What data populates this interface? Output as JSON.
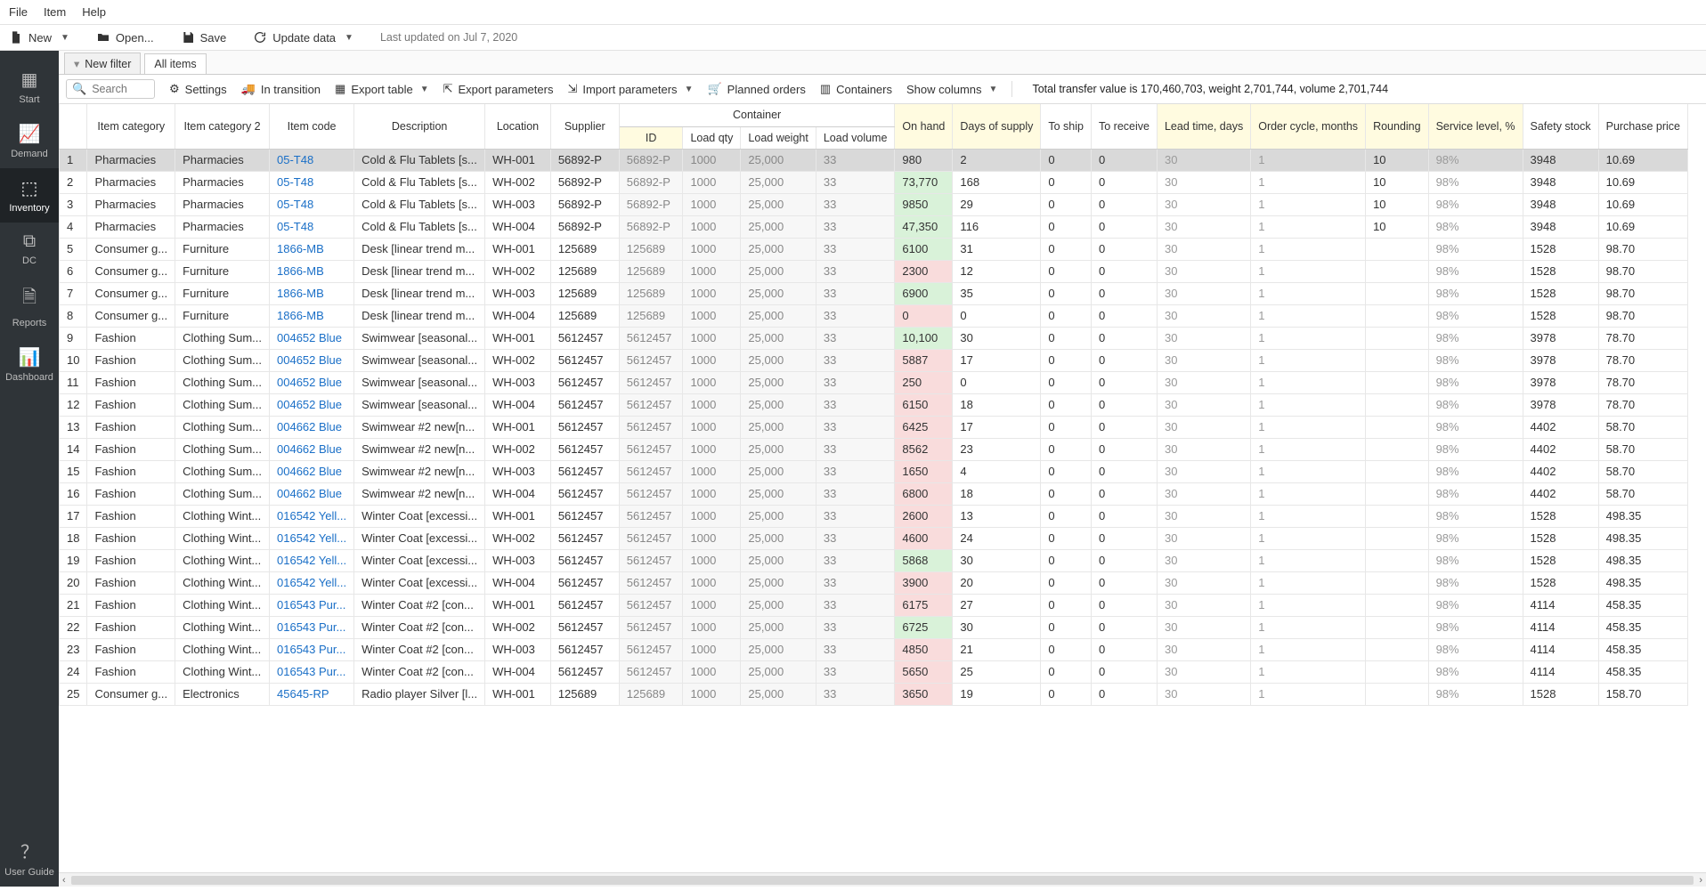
{
  "menubar": [
    "File",
    "Item",
    "Help"
  ],
  "toolbar": {
    "new": "New",
    "open": "Open...",
    "save": "Save",
    "update": "Update data",
    "timestamp": "Last updated on Jul 7, 2020"
  },
  "sidebar": {
    "items": [
      {
        "label": "Start",
        "icon": "grid"
      },
      {
        "label": "Demand",
        "icon": "line"
      },
      {
        "label": "Inventory",
        "icon": "cube",
        "active": true
      },
      {
        "label": "DC",
        "icon": "boxes"
      },
      {
        "label": "Reports",
        "icon": "doc"
      },
      {
        "label": "Dashboard",
        "icon": "bar"
      }
    ],
    "guide": "User Guide"
  },
  "tabs": {
    "newfilter": "New filter",
    "allitems": "All items"
  },
  "toolrow": {
    "search_placeholder": "Search",
    "settings": "Settings",
    "transition": "In transition",
    "export_table": "Export table",
    "export_params": "Export parameters",
    "import_params": "Import parameters",
    "planned": "Planned orders",
    "containers": "Containers",
    "show_cols": "Show columns",
    "summary": "Total transfer value is 170,460,703, weight 2,701,744, volume 2,701,744"
  },
  "columns": {
    "item_cat": "Item category",
    "item_cat2": "Item category 2",
    "item_code": "Item code",
    "desc": "Description",
    "location": "Location",
    "supplier": "Supplier",
    "container_group": "Container",
    "id": "ID",
    "load_qty": "Load qty",
    "load_wt": "Load weight",
    "load_vol": "Load volume",
    "on_hand": "On hand",
    "days_supply": "Days of supply",
    "to_ship": "To ship",
    "to_recv": "To receive",
    "lead_time": "Lead time, days",
    "order_cycle": "Order cycle, months",
    "rounding": "Rounding",
    "service": "Service level, %",
    "safety": "Safety stock",
    "price": "Purchase price"
  },
  "rows": [
    {
      "n": 1,
      "cat": "Pharmacies",
      "cat2": "Pharmacies",
      "code": "05-T48",
      "desc": "Cold & Flu Tablets [s...",
      "loc": "WH-001",
      "sup": "56892-P",
      "cid": "56892-P",
      "lq": "1000",
      "lw": "25,000",
      "lv": "33",
      "oh": "980",
      "oh_c": "r",
      "ds": "2",
      "ship": "0",
      "recv": "0",
      "lt": "30",
      "oc": "1",
      "rnd": "10",
      "sl": "98%",
      "ss": "3948",
      "pp": "10.69",
      "sel": true
    },
    {
      "n": 2,
      "cat": "Pharmacies",
      "cat2": "Pharmacies",
      "code": "05-T48",
      "desc": "Cold & Flu Tablets [s...",
      "loc": "WH-002",
      "sup": "56892-P",
      "cid": "56892-P",
      "lq": "1000",
      "lw": "25,000",
      "lv": "33",
      "oh": "73,770",
      "oh_c": "g",
      "ds": "168",
      "ship": "0",
      "recv": "0",
      "lt": "30",
      "oc": "1",
      "rnd": "10",
      "sl": "98%",
      "ss": "3948",
      "pp": "10.69"
    },
    {
      "n": 3,
      "cat": "Pharmacies",
      "cat2": "Pharmacies",
      "code": "05-T48",
      "desc": "Cold & Flu Tablets [s...",
      "loc": "WH-003",
      "sup": "56892-P",
      "cid": "56892-P",
      "lq": "1000",
      "lw": "25,000",
      "lv": "33",
      "oh": "9850",
      "oh_c": "g",
      "ds": "29",
      "ship": "0",
      "recv": "0",
      "lt": "30",
      "oc": "1",
      "rnd": "10",
      "sl": "98%",
      "ss": "3948",
      "pp": "10.69"
    },
    {
      "n": 4,
      "cat": "Pharmacies",
      "cat2": "Pharmacies",
      "code": "05-T48",
      "desc": "Cold & Flu Tablets [s...",
      "loc": "WH-004",
      "sup": "56892-P",
      "cid": "56892-P",
      "lq": "1000",
      "lw": "25,000",
      "lv": "33",
      "oh": "47,350",
      "oh_c": "g",
      "ds": "116",
      "ship": "0",
      "recv": "0",
      "lt": "30",
      "oc": "1",
      "rnd": "10",
      "sl": "98%",
      "ss": "3948",
      "pp": "10.69"
    },
    {
      "n": 5,
      "cat": "Consumer g...",
      "cat2": "Furniture",
      "code": "1866-MB",
      "desc": "Desk [linear trend m...",
      "loc": "WH-001",
      "sup": "125689",
      "cid": "125689",
      "lq": "1000",
      "lw": "25,000",
      "lv": "33",
      "oh": "6100",
      "oh_c": "g",
      "ds": "31",
      "ship": "0",
      "recv": "0",
      "lt": "30",
      "oc": "1",
      "rnd": "",
      "sl": "98%",
      "ss": "1528",
      "pp": "98.70"
    },
    {
      "n": 6,
      "cat": "Consumer g...",
      "cat2": "Furniture",
      "code": "1866-MB",
      "desc": "Desk [linear trend m...",
      "loc": "WH-002",
      "sup": "125689",
      "cid": "125689",
      "lq": "1000",
      "lw": "25,000",
      "lv": "33",
      "oh": "2300",
      "oh_c": "r",
      "ds": "12",
      "ship": "0",
      "recv": "0",
      "lt": "30",
      "oc": "1",
      "rnd": "",
      "sl": "98%",
      "ss": "1528",
      "pp": "98.70"
    },
    {
      "n": 7,
      "cat": "Consumer g...",
      "cat2": "Furniture",
      "code": "1866-MB",
      "desc": "Desk [linear trend m...",
      "loc": "WH-003",
      "sup": "125689",
      "cid": "125689",
      "lq": "1000",
      "lw": "25,000",
      "lv": "33",
      "oh": "6900",
      "oh_c": "g",
      "ds": "35",
      "ship": "0",
      "recv": "0",
      "lt": "30",
      "oc": "1",
      "rnd": "",
      "sl": "98%",
      "ss": "1528",
      "pp": "98.70"
    },
    {
      "n": 8,
      "cat": "Consumer g...",
      "cat2": "Furniture",
      "code": "1866-MB",
      "desc": "Desk [linear trend m...",
      "loc": "WH-004",
      "sup": "125689",
      "cid": "125689",
      "lq": "1000",
      "lw": "25,000",
      "lv": "33",
      "oh": "0",
      "oh_c": "r",
      "ds": "0",
      "ship": "0",
      "recv": "0",
      "lt": "30",
      "oc": "1",
      "rnd": "",
      "sl": "98%",
      "ss": "1528",
      "pp": "98.70"
    },
    {
      "n": 9,
      "cat": "Fashion",
      "cat2": "Clothing Sum...",
      "code": "004652 Blue",
      "desc": "Swimwear [seasonal...",
      "loc": "WH-001",
      "sup": "5612457",
      "cid": "5612457",
      "lq": "1000",
      "lw": "25,000",
      "lv": "33",
      "oh": "10,100",
      "oh_c": "g",
      "ds": "30",
      "ship": "0",
      "recv": "0",
      "lt": "30",
      "oc": "1",
      "rnd": "",
      "sl": "98%",
      "ss": "3978",
      "pp": "78.70"
    },
    {
      "n": 10,
      "cat": "Fashion",
      "cat2": "Clothing Sum...",
      "code": "004652 Blue",
      "desc": "Swimwear [seasonal...",
      "loc": "WH-002",
      "sup": "5612457",
      "cid": "5612457",
      "lq": "1000",
      "lw": "25,000",
      "lv": "33",
      "oh": "5887",
      "oh_c": "r",
      "ds": "17",
      "ship": "0",
      "recv": "0",
      "lt": "30",
      "oc": "1",
      "rnd": "",
      "sl": "98%",
      "ss": "3978",
      "pp": "78.70"
    },
    {
      "n": 11,
      "cat": "Fashion",
      "cat2": "Clothing Sum...",
      "code": "004652 Blue",
      "desc": "Swimwear [seasonal...",
      "loc": "WH-003",
      "sup": "5612457",
      "cid": "5612457",
      "lq": "1000",
      "lw": "25,000",
      "lv": "33",
      "oh": "250",
      "oh_c": "r",
      "ds": "0",
      "ship": "0",
      "recv": "0",
      "lt": "30",
      "oc": "1",
      "rnd": "",
      "sl": "98%",
      "ss": "3978",
      "pp": "78.70"
    },
    {
      "n": 12,
      "cat": "Fashion",
      "cat2": "Clothing Sum...",
      "code": "004652 Blue",
      "desc": "Swimwear [seasonal...",
      "loc": "WH-004",
      "sup": "5612457",
      "cid": "5612457",
      "lq": "1000",
      "lw": "25,000",
      "lv": "33",
      "oh": "6150",
      "oh_c": "r",
      "ds": "18",
      "ship": "0",
      "recv": "0",
      "lt": "30",
      "oc": "1",
      "rnd": "",
      "sl": "98%",
      "ss": "3978",
      "pp": "78.70"
    },
    {
      "n": 13,
      "cat": "Fashion",
      "cat2": "Clothing Sum...",
      "code": "004662 Blue",
      "desc": "Swimwear #2 new[n...",
      "loc": "WH-001",
      "sup": "5612457",
      "cid": "5612457",
      "lq": "1000",
      "lw": "25,000",
      "lv": "33",
      "oh": "6425",
      "oh_c": "r",
      "ds": "17",
      "ship": "0",
      "recv": "0",
      "lt": "30",
      "oc": "1",
      "rnd": "",
      "sl": "98%",
      "ss": "4402",
      "pp": "58.70"
    },
    {
      "n": 14,
      "cat": "Fashion",
      "cat2": "Clothing Sum...",
      "code": "004662 Blue",
      "desc": "Swimwear #2 new[n...",
      "loc": "WH-002",
      "sup": "5612457",
      "cid": "5612457",
      "lq": "1000",
      "lw": "25,000",
      "lv": "33",
      "oh": "8562",
      "oh_c": "r",
      "ds": "23",
      "ship": "0",
      "recv": "0",
      "lt": "30",
      "oc": "1",
      "rnd": "",
      "sl": "98%",
      "ss": "4402",
      "pp": "58.70"
    },
    {
      "n": 15,
      "cat": "Fashion",
      "cat2": "Clothing Sum...",
      "code": "004662 Blue",
      "desc": "Swimwear #2 new[n...",
      "loc": "WH-003",
      "sup": "5612457",
      "cid": "5612457",
      "lq": "1000",
      "lw": "25,000",
      "lv": "33",
      "oh": "1650",
      "oh_c": "r",
      "ds": "4",
      "ship": "0",
      "recv": "0",
      "lt": "30",
      "oc": "1",
      "rnd": "",
      "sl": "98%",
      "ss": "4402",
      "pp": "58.70"
    },
    {
      "n": 16,
      "cat": "Fashion",
      "cat2": "Clothing Sum...",
      "code": "004662 Blue",
      "desc": "Swimwear #2 new[n...",
      "loc": "WH-004",
      "sup": "5612457",
      "cid": "5612457",
      "lq": "1000",
      "lw": "25,000",
      "lv": "33",
      "oh": "6800",
      "oh_c": "r",
      "ds": "18",
      "ship": "0",
      "recv": "0",
      "lt": "30",
      "oc": "1",
      "rnd": "",
      "sl": "98%",
      "ss": "4402",
      "pp": "58.70"
    },
    {
      "n": 17,
      "cat": "Fashion",
      "cat2": "Clothing Wint...",
      "code": "016542 Yell...",
      "desc": "Winter Coat [excessi...",
      "loc": "WH-001",
      "sup": "5612457",
      "cid": "5612457",
      "lq": "1000",
      "lw": "25,000",
      "lv": "33",
      "oh": "2600",
      "oh_c": "r",
      "ds": "13",
      "ship": "0",
      "recv": "0",
      "lt": "30",
      "oc": "1",
      "rnd": "",
      "sl": "98%",
      "ss": "1528",
      "pp": "498.35"
    },
    {
      "n": 18,
      "cat": "Fashion",
      "cat2": "Clothing Wint...",
      "code": "016542 Yell...",
      "desc": "Winter Coat [excessi...",
      "loc": "WH-002",
      "sup": "5612457",
      "cid": "5612457",
      "lq": "1000",
      "lw": "25,000",
      "lv": "33",
      "oh": "4600",
      "oh_c": "r",
      "ds": "24",
      "ship": "0",
      "recv": "0",
      "lt": "30",
      "oc": "1",
      "rnd": "",
      "sl": "98%",
      "ss": "1528",
      "pp": "498.35"
    },
    {
      "n": 19,
      "cat": "Fashion",
      "cat2": "Clothing Wint...",
      "code": "016542 Yell...",
      "desc": "Winter Coat [excessi...",
      "loc": "WH-003",
      "sup": "5612457",
      "cid": "5612457",
      "lq": "1000",
      "lw": "25,000",
      "lv": "33",
      "oh": "5868",
      "oh_c": "g",
      "ds": "30",
      "ship": "0",
      "recv": "0",
      "lt": "30",
      "oc": "1",
      "rnd": "",
      "sl": "98%",
      "ss": "1528",
      "pp": "498.35"
    },
    {
      "n": 20,
      "cat": "Fashion",
      "cat2": "Clothing Wint...",
      "code": "016542 Yell...",
      "desc": "Winter Coat [excessi...",
      "loc": "WH-004",
      "sup": "5612457",
      "cid": "5612457",
      "lq": "1000",
      "lw": "25,000",
      "lv": "33",
      "oh": "3900",
      "oh_c": "r",
      "ds": "20",
      "ship": "0",
      "recv": "0",
      "lt": "30",
      "oc": "1",
      "rnd": "",
      "sl": "98%",
      "ss": "1528",
      "pp": "498.35"
    },
    {
      "n": 21,
      "cat": "Fashion",
      "cat2": "Clothing Wint...",
      "code": "016543 Pur...",
      "desc": "Winter Coat #2 [con...",
      "loc": "WH-001",
      "sup": "5612457",
      "cid": "5612457",
      "lq": "1000",
      "lw": "25,000",
      "lv": "33",
      "oh": "6175",
      "oh_c": "r",
      "ds": "27",
      "ship": "0",
      "recv": "0",
      "lt": "30",
      "oc": "1",
      "rnd": "",
      "sl": "98%",
      "ss": "4114",
      "pp": "458.35"
    },
    {
      "n": 22,
      "cat": "Fashion",
      "cat2": "Clothing Wint...",
      "code": "016543 Pur...",
      "desc": "Winter Coat #2 [con...",
      "loc": "WH-002",
      "sup": "5612457",
      "cid": "5612457",
      "lq": "1000",
      "lw": "25,000",
      "lv": "33",
      "oh": "6725",
      "oh_c": "g",
      "ds": "30",
      "ship": "0",
      "recv": "0",
      "lt": "30",
      "oc": "1",
      "rnd": "",
      "sl": "98%",
      "ss": "4114",
      "pp": "458.35"
    },
    {
      "n": 23,
      "cat": "Fashion",
      "cat2": "Clothing Wint...",
      "code": "016543 Pur...",
      "desc": "Winter Coat #2 [con...",
      "loc": "WH-003",
      "sup": "5612457",
      "cid": "5612457",
      "lq": "1000",
      "lw": "25,000",
      "lv": "33",
      "oh": "4850",
      "oh_c": "r",
      "ds": "21",
      "ship": "0",
      "recv": "0",
      "lt": "30",
      "oc": "1",
      "rnd": "",
      "sl": "98%",
      "ss": "4114",
      "pp": "458.35"
    },
    {
      "n": 24,
      "cat": "Fashion",
      "cat2": "Clothing Wint...",
      "code": "016543 Pur...",
      "desc": "Winter Coat #2 [con...",
      "loc": "WH-004",
      "sup": "5612457",
      "cid": "5612457",
      "lq": "1000",
      "lw": "25,000",
      "lv": "33",
      "oh": "5650",
      "oh_c": "r",
      "ds": "25",
      "ship": "0",
      "recv": "0",
      "lt": "30",
      "oc": "1",
      "rnd": "",
      "sl": "98%",
      "ss": "4114",
      "pp": "458.35"
    },
    {
      "n": 25,
      "cat": "Consumer g...",
      "cat2": "Electronics",
      "code": "45645-RP",
      "desc": "Radio player Silver [l...",
      "loc": "WH-001",
      "sup": "125689",
      "cid": "125689",
      "lq": "1000",
      "lw": "25,000",
      "lv": "33",
      "oh": "3650",
      "oh_c": "r",
      "ds": "19",
      "ship": "0",
      "recv": "0",
      "lt": "30",
      "oc": "1",
      "rnd": "",
      "sl": "98%",
      "ss": "1528",
      "pp": "158.70"
    }
  ]
}
